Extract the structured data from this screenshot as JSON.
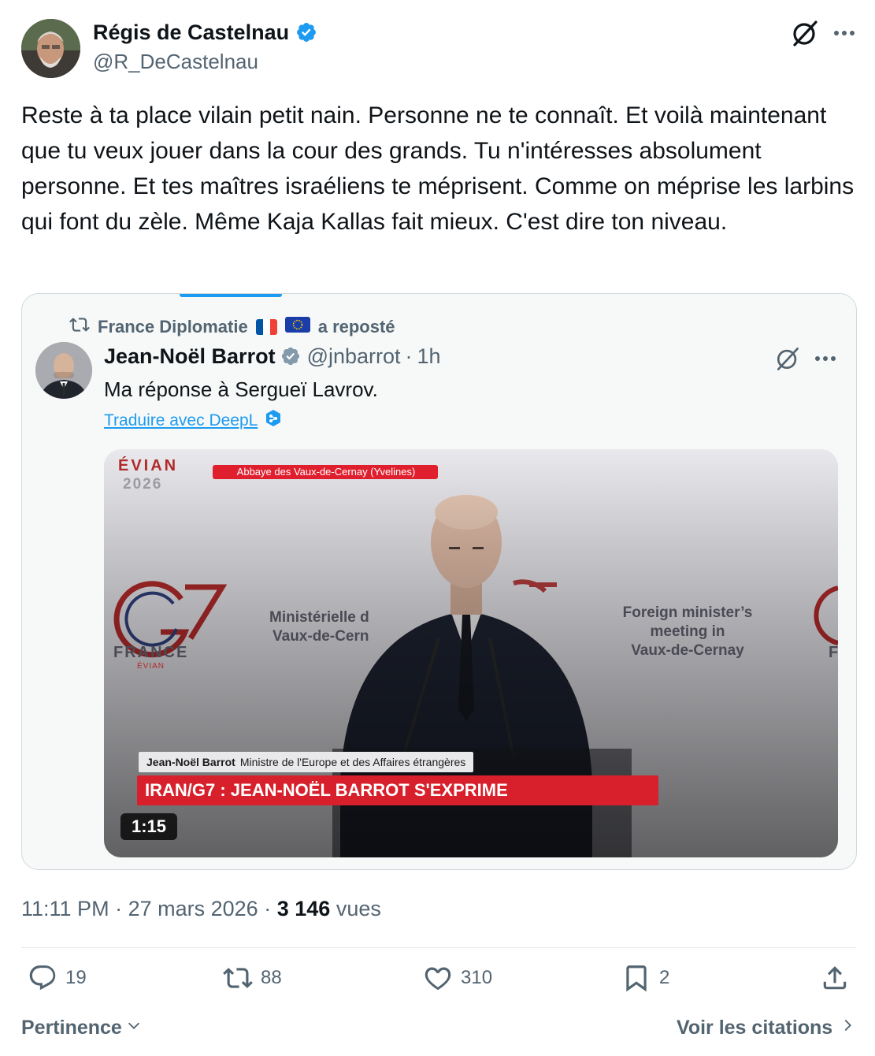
{
  "author": {
    "name": "Régis de Castelnau",
    "handle": "@R_DeCastelnau"
  },
  "tweet": {
    "text": "Reste à ta place vilain petit nain. Personne ne te connaît. Et voilà maintenant que tu veux jouer dans la cour des grands. Tu n'intéresses absolument personne. Et tes maîtres israéliens te méprisent. Comme on méprise les larbins qui font du zèle.  Même Kaja Kallas fait mieux. C'est dire ton niveau."
  },
  "quote": {
    "repost_account": "France Diplomatie",
    "repost_suffix": "a reposté",
    "name": "Jean-Noël Barrot",
    "handle": "@jnbarrot",
    "separator": "·",
    "time": "1h",
    "text": "Ma réponse à Sergueï Lavrov.",
    "translate_label": "Traduire avec DeepL",
    "video": {
      "logo_top_line1": "ÉVIAN",
      "logo_top_line2": "2026",
      "location_tag": "Abbaye des Vaux-de-Cernay (Yvelines)",
      "g7_label": "G7",
      "g7_country": "FRANCE",
      "g7_city": "ÉVIAN",
      "g7_year": "2026",
      "banner_fr_line1": "Ministérielle d",
      "banner_fr_line2": "Vaux-de-Cern",
      "banner_en_line1": "Foreign minister’s",
      "banner_en_line2": "meeting in",
      "banner_en_line3": "Vaux-de-Cernay",
      "banner_right_letter": "F",
      "lower_third_name": "Jean-Noël Barrot",
      "lower_third_title": "Ministre de l'Europe et des Affaires étrangères",
      "headline": "IRAN/G7 : JEAN-NOËL BARROT S'EXPRIME",
      "duration": "1:15"
    }
  },
  "meta": {
    "time": "11:11 PM",
    "date": "27 mars 2026",
    "separator": "·",
    "views_count": "3 146",
    "views_label": "vues"
  },
  "actions": {
    "replies": "19",
    "reposts": "88",
    "likes": "310",
    "bookmarks": "2"
  },
  "footer": {
    "sort_label": "Pertinence",
    "quotes_link": "Voir les citations"
  },
  "colors": {
    "accent": "#1d9bf0",
    "muted": "#536471",
    "text": "#0f1419",
    "news_red": "#d7202b"
  }
}
